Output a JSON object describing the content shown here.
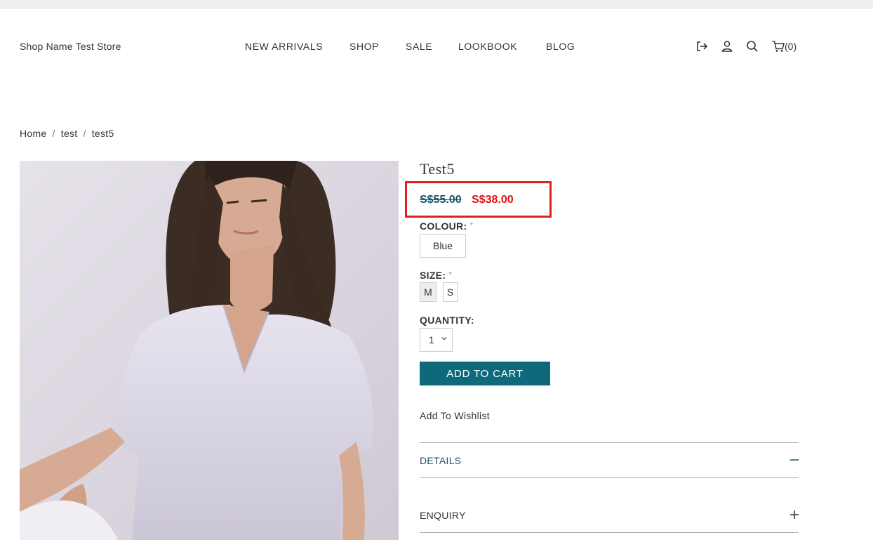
{
  "header": {
    "store_name": "Shop Name Test Store",
    "nav": [
      "NEW ARRIVALS",
      "SHOP",
      "SALE",
      "LOOKBOOK",
      "BLOG"
    ],
    "icons": [
      "logout-icon",
      "user-icon",
      "search-icon",
      "cart-icon"
    ],
    "cart_count": "(0)"
  },
  "breadcrumb": [
    "Home",
    "test",
    "test5"
  ],
  "product": {
    "title": "Test5",
    "old_price": "S$55.00",
    "new_price": "S$38.00",
    "colour_label": "COLOUR:",
    "colour_value": "Blue",
    "size_label": "SIZE:",
    "sizes": [
      "M",
      "S"
    ],
    "selected_size": "M",
    "required_mark": "*",
    "quantity_label": "QUANTITY:",
    "quantity_value": "1",
    "add_to_cart": "ADD TO CART",
    "wishlist": "Add To Wishlist",
    "accordion": [
      {
        "label": "DETAILS",
        "state": "expanded",
        "icon": "minus-icon"
      },
      {
        "label": "ENQUIRY",
        "state": "collapsed",
        "icon": "plus-icon"
      }
    ]
  },
  "colors": {
    "accent": "#0e6a7b",
    "sale_price": "#e01010",
    "old_price": "#1b5565",
    "highlight_box": "#e02020"
  }
}
